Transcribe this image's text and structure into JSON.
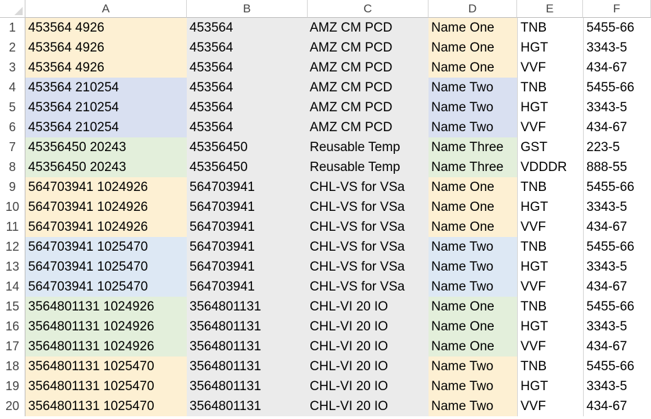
{
  "columns": [
    "A",
    "B",
    "C",
    "D",
    "E",
    "F"
  ],
  "colors": {
    "peach": "#fdf0d3",
    "blue_gray": "#d9e0f1",
    "green": "#e3efdb",
    "light_blue": "#dde8f4",
    "gray": "#ebebeb"
  },
  "rows": [
    {
      "num": "1",
      "a": "453564 4926",
      "b": "453564",
      "c": "AMZ CM PCD",
      "d": "Name One",
      "e": "TNB",
      "f": "5455-66",
      "color": "#fdf0d3"
    },
    {
      "num": "2",
      "a": "453564 4926",
      "b": "453564",
      "c": "AMZ CM PCD",
      "d": "Name One",
      "e": "HGT",
      "f": "3343-5",
      "color": "#fdf0d3"
    },
    {
      "num": "3",
      "a": "453564 4926",
      "b": "453564",
      "c": "AMZ CM PCD",
      "d": "Name One",
      "e": "VVF",
      "f": "434-67",
      "color": "#fdf0d3"
    },
    {
      "num": "4",
      "a": "453564 210254",
      "b": "453564",
      "c": "AMZ CM PCD",
      "d": "Name Two",
      "e": "TNB",
      "f": "5455-66",
      "color": "#d9e0f1"
    },
    {
      "num": "5",
      "a": "453564 210254",
      "b": "453564",
      "c": "AMZ CM PCD",
      "d": "Name Two",
      "e": "HGT",
      "f": "3343-5",
      "color": "#d9e0f1"
    },
    {
      "num": "6",
      "a": "453564 210254",
      "b": "453564",
      "c": "AMZ CM PCD",
      "d": "Name Two",
      "e": "VVF",
      "f": "434-67",
      "color": "#d9e0f1"
    },
    {
      "num": "7",
      "a": "45356450 20243",
      "b": "45356450",
      "c": "Reusable Temp",
      "d": "Name Three",
      "e": "GST",
      "f": "223-5",
      "color": "#e3efdb"
    },
    {
      "num": "8",
      "a": "45356450 20243",
      "b": "45356450",
      "c": "Reusable Temp",
      "d": "Name Three",
      "e": "VDDDR",
      "f": "888-55",
      "color": "#e3efdb"
    },
    {
      "num": "9",
      "a": "564703941 1024926",
      "b": "564703941",
      "c": "CHL-VS for VSa",
      "d": "Name One",
      "e": "TNB",
      "f": "5455-66",
      "color": "#fdf0d3"
    },
    {
      "num": "10",
      "a": "564703941 1024926",
      "b": "564703941",
      "c": "CHL-VS for VSa",
      "d": "Name One",
      "e": "HGT",
      "f": "3343-5",
      "color": "#fdf0d3"
    },
    {
      "num": "11",
      "a": "564703941 1024926",
      "b": "564703941",
      "c": "CHL-VS for VSa",
      "d": "Name One",
      "e": "VVF",
      "f": "434-67",
      "color": "#fdf0d3"
    },
    {
      "num": "12",
      "a": "564703941 1025470",
      "b": "564703941",
      "c": "CHL-VS for VSa",
      "d": "Name Two",
      "e": "TNB",
      "f": "5455-66",
      "color": "#dde8f4"
    },
    {
      "num": "13",
      "a": "564703941 1025470",
      "b": "564703941",
      "c": "CHL-VS for VSa",
      "d": "Name Two",
      "e": "HGT",
      "f": "3343-5",
      "color": "#dde8f4"
    },
    {
      "num": "14",
      "a": "564703941 1025470",
      "b": "564703941",
      "c": "CHL-VS for VSa",
      "d": "Name Two",
      "e": "VVF",
      "f": "434-67",
      "color": "#dde8f4"
    },
    {
      "num": "15",
      "a": "3564801131 1024926",
      "b": "3564801131",
      "c": "CHL-VI 20 IO",
      "d": "Name One",
      "e": "TNB",
      "f": "5455-66",
      "color": "#e3efdb"
    },
    {
      "num": "16",
      "a": "3564801131 1024926",
      "b": "3564801131",
      "c": "CHL-VI 20 IO",
      "d": "Name One",
      "e": "HGT",
      "f": "3343-5",
      "color": "#e3efdb"
    },
    {
      "num": "17",
      "a": "3564801131 1024926",
      "b": "3564801131",
      "c": "CHL-VI 20 IO",
      "d": "Name One",
      "e": "VVF",
      "f": "434-67",
      "color": "#e3efdb"
    },
    {
      "num": "18",
      "a": "3564801131 1025470",
      "b": "3564801131",
      "c": "CHL-VI 20 IO",
      "d": "Name Two",
      "e": "TNB",
      "f": "5455-66",
      "color": "#fdf0d3"
    },
    {
      "num": "19",
      "a": "3564801131 1025470",
      "b": "3564801131",
      "c": "CHL-VI 20 IO",
      "d": "Name Two",
      "e": "HGT",
      "f": "3343-5",
      "color": "#fdf0d3"
    },
    {
      "num": "20",
      "a": "3564801131 1025470",
      "b": "3564801131",
      "c": "CHL-VI 20 IO",
      "d": "Name Two",
      "e": "VVF",
      "f": "434-67",
      "color": "#fdf0d3"
    }
  ]
}
